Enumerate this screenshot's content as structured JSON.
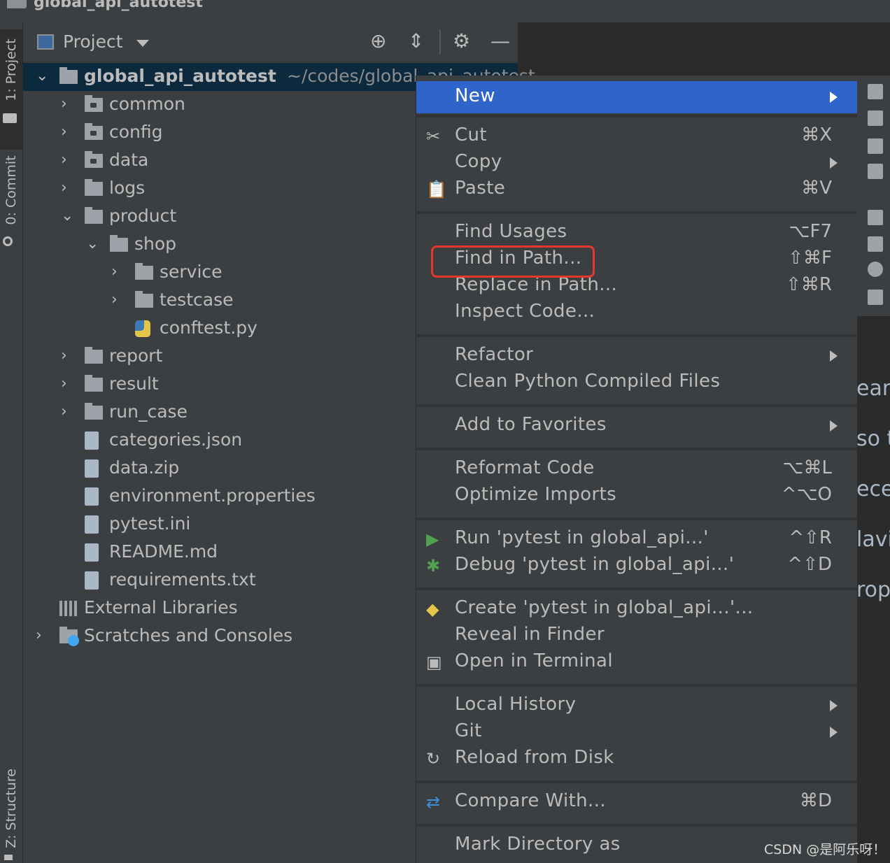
{
  "window": {
    "title": "global_api_autotest"
  },
  "left_tool_strip": {
    "project_tab": "1: Project",
    "commit_tab": "0: Commit",
    "structure_tab": "Z: Structure"
  },
  "project_panel": {
    "header": {
      "label": "Project",
      "locate_icon": "crosshair-icon",
      "collapse_icon": "collapse-all-icon",
      "settings_icon": "gear-icon",
      "hide_icon": "minus-icon"
    },
    "tree": [
      {
        "label": "global_api_autotest",
        "path": "~/codes/global_api_autotest",
        "kind": "folder",
        "depth": 0,
        "chev": "⌄",
        "selected": true,
        "bold": true
      },
      {
        "label": "common",
        "kind": "folder-dot",
        "depth": 1,
        "chev": "›"
      },
      {
        "label": "config",
        "kind": "folder-dot",
        "depth": 1,
        "chev": "›"
      },
      {
        "label": "data",
        "kind": "folder-dot",
        "depth": 1,
        "chev": "›"
      },
      {
        "label": "logs",
        "kind": "folder",
        "depth": 1,
        "chev": "›"
      },
      {
        "label": "product",
        "kind": "folder",
        "depth": 1,
        "chev": "⌄"
      },
      {
        "label": "shop",
        "kind": "folder",
        "depth": 2,
        "chev": "⌄"
      },
      {
        "label": "service",
        "kind": "folder",
        "depth": 3,
        "chev": "›"
      },
      {
        "label": "testcase",
        "kind": "folder",
        "depth": 3,
        "chev": "›"
      },
      {
        "label": "conftest.py",
        "kind": "python",
        "depth": 3,
        "chev": ""
      },
      {
        "label": "report",
        "kind": "folder",
        "depth": 1,
        "chev": "›"
      },
      {
        "label": "result",
        "kind": "folder",
        "depth": 1,
        "chev": "›"
      },
      {
        "label": "run_case",
        "kind": "folder",
        "depth": 1,
        "chev": "›"
      },
      {
        "label": "categories.json",
        "kind": "file",
        "depth": 1,
        "chev": ""
      },
      {
        "label": "data.zip",
        "kind": "file",
        "depth": 1,
        "chev": ""
      },
      {
        "label": "environment.properties",
        "kind": "file",
        "depth": 1,
        "chev": ""
      },
      {
        "label": "pytest.ini",
        "kind": "file",
        "depth": 1,
        "chev": ""
      },
      {
        "label": "README.md",
        "kind": "file",
        "depth": 1,
        "chev": ""
      },
      {
        "label": "requirements.txt",
        "kind": "file",
        "depth": 1,
        "chev": ""
      },
      {
        "label": "External Libraries",
        "kind": "libraries",
        "depth": 0,
        "chev": ""
      },
      {
        "label": "Scratches and Consoles",
        "kind": "scratches",
        "depth": 0,
        "chev": "›"
      }
    ]
  },
  "context_menu": {
    "highlighted": "New",
    "items": [
      {
        "label": "New",
        "submenu": true,
        "group": 0
      },
      {
        "label": "Cut",
        "shortcut": "⌘X",
        "icon": "scissors-icon",
        "glyph": "✂",
        "group": 1
      },
      {
        "label": "Copy",
        "submenu": true,
        "group": 1
      },
      {
        "label": "Paste",
        "shortcut": "⌘V",
        "icon": "clipboard-icon",
        "glyph": "📋",
        "group": 1
      },
      {
        "label": "Find Usages",
        "shortcut": "⌥F7",
        "group": 2
      },
      {
        "label": "Find in Path...",
        "shortcut": "⇧⌘F",
        "group": 2,
        "annotated": true
      },
      {
        "label": "Replace in Path...",
        "shortcut": "⇧⌘R",
        "group": 2
      },
      {
        "label": "Inspect Code...",
        "group": 2
      },
      {
        "label": "Refactor",
        "submenu": true,
        "group": 3
      },
      {
        "label": "Clean Python Compiled Files",
        "group": 3
      },
      {
        "label": "Add to Favorites",
        "submenu": true,
        "group": 4
      },
      {
        "label": "Reformat Code",
        "shortcut": "⌥⌘L",
        "group": 5
      },
      {
        "label": "Optimize Imports",
        "shortcut": "^⌥O",
        "group": 5
      },
      {
        "label": "Run 'pytest in global_api...'",
        "shortcut": "^⇧R",
        "icon": "run-icon",
        "glyph": "▶",
        "color": "#4fa34f",
        "group": 6
      },
      {
        "label": "Debug 'pytest in global_api...'",
        "shortcut": "^⇧D",
        "icon": "bug-icon",
        "glyph": "✱",
        "color": "#4fa34f",
        "group": 6
      },
      {
        "label": "Create 'pytest in global_api...'...",
        "icon": "python-icon",
        "glyph": "◆",
        "color": "#e5c44a",
        "group": 7
      },
      {
        "label": "Reveal in Finder",
        "group": 7
      },
      {
        "label": "Open in Terminal",
        "icon": "terminal-icon",
        "glyph": "▣",
        "group": 7
      },
      {
        "label": "Local History",
        "submenu": true,
        "group": 8
      },
      {
        "label": "Git",
        "submenu": true,
        "group": 8
      },
      {
        "label": "Reload from Disk",
        "icon": "reload-icon",
        "glyph": "↻",
        "group": 8
      },
      {
        "label": "Compare With...",
        "shortcut": "⌘D",
        "icon": "compare-icon",
        "glyph": "⇄",
        "color": "#3f8fd8",
        "group": 9
      },
      {
        "label": "Mark Directory as",
        "group": 10
      }
    ]
  },
  "editor_fragments": [
    "ear",
    "so t",
    "ece",
    "lavi",
    "rop"
  ],
  "watermark": "CSDN @是阿乐呀！",
  "colors": {
    "highlight": "#2f65ca",
    "annotation": "#e5372c",
    "selection": "#0d293e"
  }
}
